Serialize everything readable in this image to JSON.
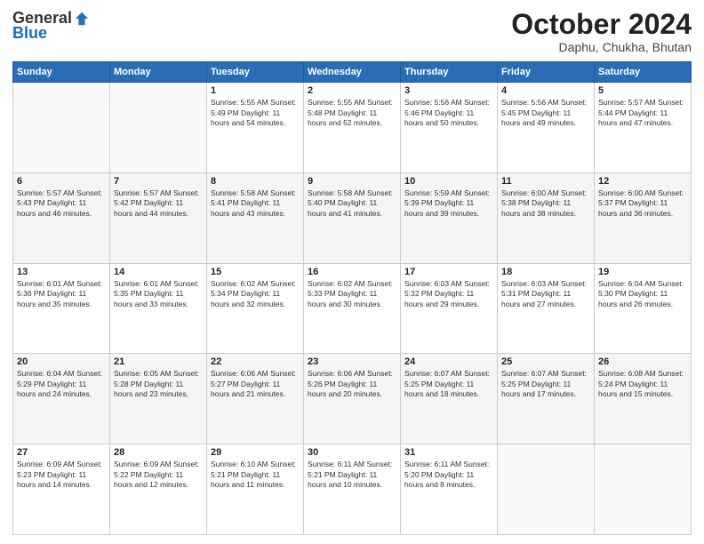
{
  "header": {
    "logo_general": "General",
    "logo_blue": "Blue",
    "month_title": "October 2024",
    "location": "Daphu, Chukha, Bhutan"
  },
  "calendar": {
    "days_of_week": [
      "Sunday",
      "Monday",
      "Tuesday",
      "Wednesday",
      "Thursday",
      "Friday",
      "Saturday"
    ],
    "weeks": [
      [
        {
          "day": "",
          "info": ""
        },
        {
          "day": "",
          "info": ""
        },
        {
          "day": "1",
          "info": "Sunrise: 5:55 AM\nSunset: 5:49 PM\nDaylight: 11 hours and 54 minutes."
        },
        {
          "day": "2",
          "info": "Sunrise: 5:55 AM\nSunset: 5:48 PM\nDaylight: 11 hours and 52 minutes."
        },
        {
          "day": "3",
          "info": "Sunrise: 5:56 AM\nSunset: 5:46 PM\nDaylight: 11 hours and 50 minutes."
        },
        {
          "day": "4",
          "info": "Sunrise: 5:56 AM\nSunset: 5:45 PM\nDaylight: 11 hours and 49 minutes."
        },
        {
          "day": "5",
          "info": "Sunrise: 5:57 AM\nSunset: 5:44 PM\nDaylight: 11 hours and 47 minutes."
        }
      ],
      [
        {
          "day": "6",
          "info": "Sunrise: 5:57 AM\nSunset: 5:43 PM\nDaylight: 11 hours and 46 minutes."
        },
        {
          "day": "7",
          "info": "Sunrise: 5:57 AM\nSunset: 5:42 PM\nDaylight: 11 hours and 44 minutes."
        },
        {
          "day": "8",
          "info": "Sunrise: 5:58 AM\nSunset: 5:41 PM\nDaylight: 11 hours and 43 minutes."
        },
        {
          "day": "9",
          "info": "Sunrise: 5:58 AM\nSunset: 5:40 PM\nDaylight: 11 hours and 41 minutes."
        },
        {
          "day": "10",
          "info": "Sunrise: 5:59 AM\nSunset: 5:39 PM\nDaylight: 11 hours and 39 minutes."
        },
        {
          "day": "11",
          "info": "Sunrise: 6:00 AM\nSunset: 5:38 PM\nDaylight: 11 hours and 38 minutes."
        },
        {
          "day": "12",
          "info": "Sunrise: 6:00 AM\nSunset: 5:37 PM\nDaylight: 11 hours and 36 minutes."
        }
      ],
      [
        {
          "day": "13",
          "info": "Sunrise: 6:01 AM\nSunset: 5:36 PM\nDaylight: 11 hours and 35 minutes."
        },
        {
          "day": "14",
          "info": "Sunrise: 6:01 AM\nSunset: 5:35 PM\nDaylight: 11 hours and 33 minutes."
        },
        {
          "day": "15",
          "info": "Sunrise: 6:02 AM\nSunset: 5:34 PM\nDaylight: 11 hours and 32 minutes."
        },
        {
          "day": "16",
          "info": "Sunrise: 6:02 AM\nSunset: 5:33 PM\nDaylight: 11 hours and 30 minutes."
        },
        {
          "day": "17",
          "info": "Sunrise: 6:03 AM\nSunset: 5:32 PM\nDaylight: 11 hours and 29 minutes."
        },
        {
          "day": "18",
          "info": "Sunrise: 6:03 AM\nSunset: 5:31 PM\nDaylight: 11 hours and 27 minutes."
        },
        {
          "day": "19",
          "info": "Sunrise: 6:04 AM\nSunset: 5:30 PM\nDaylight: 11 hours and 26 minutes."
        }
      ],
      [
        {
          "day": "20",
          "info": "Sunrise: 6:04 AM\nSunset: 5:29 PM\nDaylight: 11 hours and 24 minutes."
        },
        {
          "day": "21",
          "info": "Sunrise: 6:05 AM\nSunset: 5:28 PM\nDaylight: 11 hours and 23 minutes."
        },
        {
          "day": "22",
          "info": "Sunrise: 6:06 AM\nSunset: 5:27 PM\nDaylight: 11 hours and 21 minutes."
        },
        {
          "day": "23",
          "info": "Sunrise: 6:06 AM\nSunset: 5:26 PM\nDaylight: 11 hours and 20 minutes."
        },
        {
          "day": "24",
          "info": "Sunrise: 6:07 AM\nSunset: 5:25 PM\nDaylight: 11 hours and 18 minutes."
        },
        {
          "day": "25",
          "info": "Sunrise: 6:07 AM\nSunset: 5:25 PM\nDaylight: 11 hours and 17 minutes."
        },
        {
          "day": "26",
          "info": "Sunrise: 6:08 AM\nSunset: 5:24 PM\nDaylight: 11 hours and 15 minutes."
        }
      ],
      [
        {
          "day": "27",
          "info": "Sunrise: 6:09 AM\nSunset: 5:23 PM\nDaylight: 11 hours and 14 minutes."
        },
        {
          "day": "28",
          "info": "Sunrise: 6:09 AM\nSunset: 5:22 PM\nDaylight: 11 hours and 12 minutes."
        },
        {
          "day": "29",
          "info": "Sunrise: 6:10 AM\nSunset: 5:21 PM\nDaylight: 11 hours and 11 minutes."
        },
        {
          "day": "30",
          "info": "Sunrise: 6:11 AM\nSunset: 5:21 PM\nDaylight: 11 hours and 10 minutes."
        },
        {
          "day": "31",
          "info": "Sunrise: 6:11 AM\nSunset: 5:20 PM\nDaylight: 11 hours and 8 minutes."
        },
        {
          "day": "",
          "info": ""
        },
        {
          "day": "",
          "info": ""
        }
      ]
    ]
  }
}
